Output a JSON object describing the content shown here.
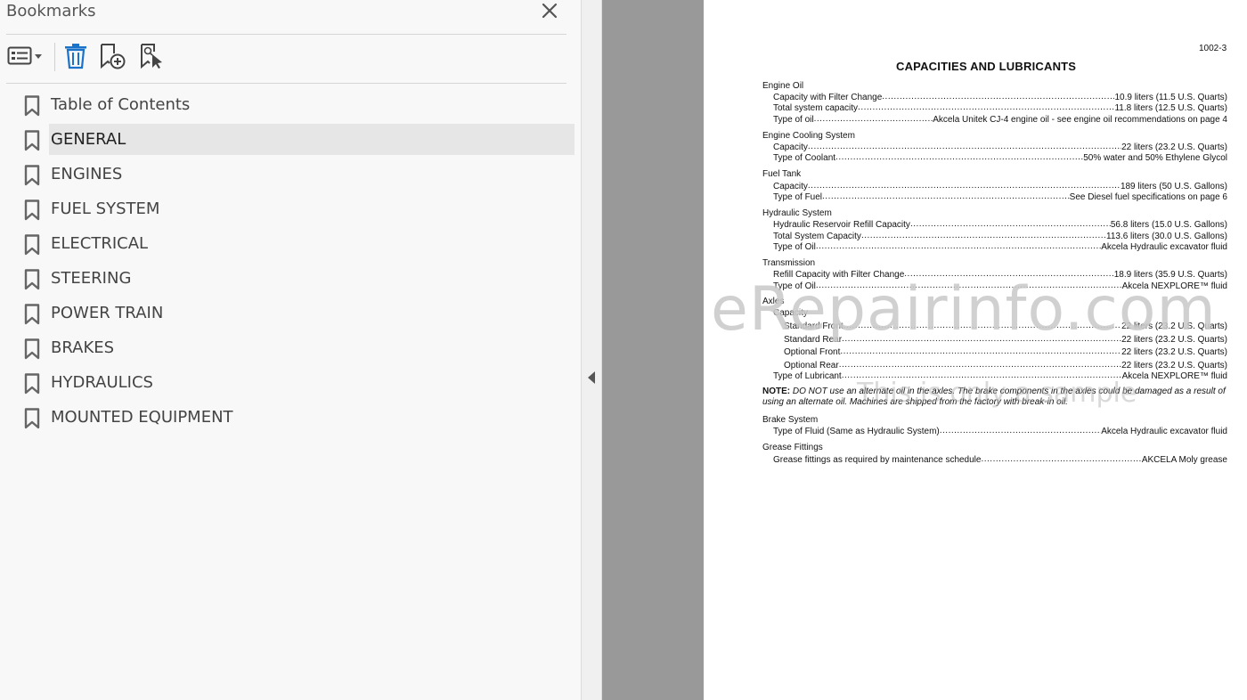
{
  "panel": {
    "title": "Bookmarks",
    "bookmarks": [
      {
        "label": "Table of Contents",
        "selected": false
      },
      {
        "label": "GENERAL",
        "selected": true
      },
      {
        "label": "ENGINES",
        "selected": false
      },
      {
        "label": "FUEL SYSTEM",
        "selected": false
      },
      {
        "label": "ELECTRICAL",
        "selected": false
      },
      {
        "label": "STEERING",
        "selected": false
      },
      {
        "label": "POWER TRAIN",
        "selected": false
      },
      {
        "label": "BRAKES",
        "selected": false
      },
      {
        "label": "HYDRAULICS",
        "selected": false
      },
      {
        "label": "MOUNTED EQUIPMENT",
        "selected": false
      }
    ],
    "icons": {
      "options": "list-options-icon",
      "delete": "trash-icon",
      "new": "add-bookmark-icon",
      "find": "find-bookmark-icon",
      "close": "close-icon",
      "bookmark": "bookmark-icon"
    },
    "accent_color": "#1a73c8"
  },
  "document": {
    "page_number": "1002-3",
    "title": "CAPACITIES AND LUBRICANTS",
    "sections": [
      {
        "heading": "Engine Oil",
        "rows": [
          {
            "label": "Capacity with Filter Change",
            "value": "10.9 liters (11.5 U.S. Quarts)"
          },
          {
            "label": "Total system capacity",
            "value": "11.8 liters (12.5 U.S. Quarts)"
          },
          {
            "label": "Type of oil",
            "value": "Akcela Unitek CJ-4 engine oil - see engine oil recommendations on page 4"
          }
        ]
      },
      {
        "heading": "Engine Cooling System",
        "rows": [
          {
            "label": "Capacity",
            "value": "22 liters (23.2 U.S. Quarts)"
          },
          {
            "label": "Type of Coolant",
            "value": "50% water and 50% Ethylene Glycol"
          }
        ]
      },
      {
        "heading": "Fuel Tank",
        "rows": [
          {
            "label": "Capacity",
            "value": "189 liters (50 U.S. Gallons)"
          },
          {
            "label": "Type of Fuel",
            "value": "See Diesel fuel specifications on page 6"
          }
        ]
      },
      {
        "heading": "Hydraulic System",
        "rows": [
          {
            "label": "Hydraulic Reservoir Refill Capacity",
            "value": "56.8 liters (15.0 U.S. Gallons)"
          },
          {
            "label": "Total System Capacity",
            "value": "113.6 liters (30.0 U.S. Gallons)"
          },
          {
            "label": "Type of Oil",
            "value": "Akcela Hydraulic excavator fluid"
          }
        ]
      },
      {
        "heading": "Transmission",
        "rows": [
          {
            "label": "Refill Capacity with Filter Change",
            "value": "18.9 liters (35.9 U.S. Quarts)"
          },
          {
            "label": "Type of Oil",
            "value": "Akcela NEXPLORE™ fluid"
          }
        ]
      },
      {
        "heading": "Axles",
        "subheading": "Capacity",
        "rows": [
          {
            "label": "Standard Front",
            "value": "22 liters (23.2 U.S. Quarts)"
          },
          {
            "label": "Standard Rear",
            "value": "22 liters (23.2 U.S. Quarts)"
          },
          {
            "label": "Optional Front",
            "value": "22 liters (23.2 U.S. Quarts)"
          },
          {
            "label": "Optional Rear",
            "value": "22 liters (23.2 U.S. Quarts)"
          },
          {
            "label": "Type of Lubricant",
            "value": "Akcela NEXPLORE™ fluid"
          }
        ]
      },
      {
        "heading": "Brake System",
        "rows": [
          {
            "label": "Type of Fluid (Same as Hydraulic System)",
            "value": "Akcela Hydraulic excavator fluid"
          }
        ]
      },
      {
        "heading": "Grease Fittings",
        "rows": [
          {
            "label": "Grease fittings as required by maintenance schedule",
            "value": "AKCELA Moly grease"
          }
        ]
      }
    ],
    "note_prefix": "NOTE:",
    "note_text": "DO NOT use an alternate oil in the axles. The brake components in the axles could be damaged as a result of using an alternate oil. Machines are shipped from the factory with break-in oil.",
    "watermark": "eRepairinfo.com",
    "watermark_sub": "This is only a sample"
  }
}
